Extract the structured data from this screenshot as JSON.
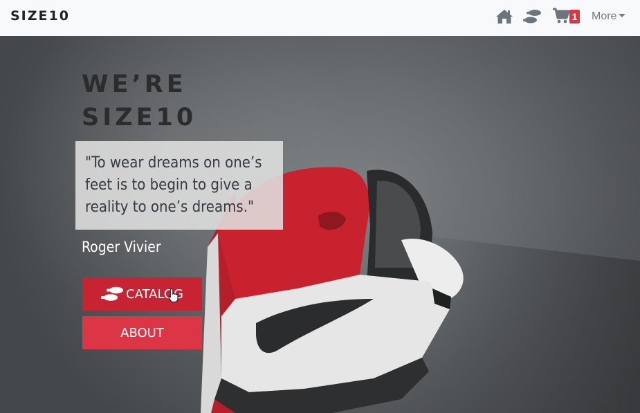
{
  "navbar": {
    "brand": "SIZE10",
    "home_icon": "home-icon",
    "footsteps_icon": "footsteps-icon",
    "cart_icon": "cart-icon",
    "cart_count": "1",
    "more_label": "More"
  },
  "hero": {
    "headline_line1": "WE’RE",
    "headline_line2": "SIZE10",
    "quote": "\"To wear dreams on one’s feet is to begin to give a reality to one’s dreams.\"",
    "author": "Roger Vivier",
    "catalog_label": "CATALOG",
    "about_label": "ABOUT"
  },
  "colors": {
    "accent": "#dc3545",
    "accent_dark": "#c82333",
    "navbar_bg": "#f8f9fa",
    "hero_bg": "#5b5f62"
  }
}
